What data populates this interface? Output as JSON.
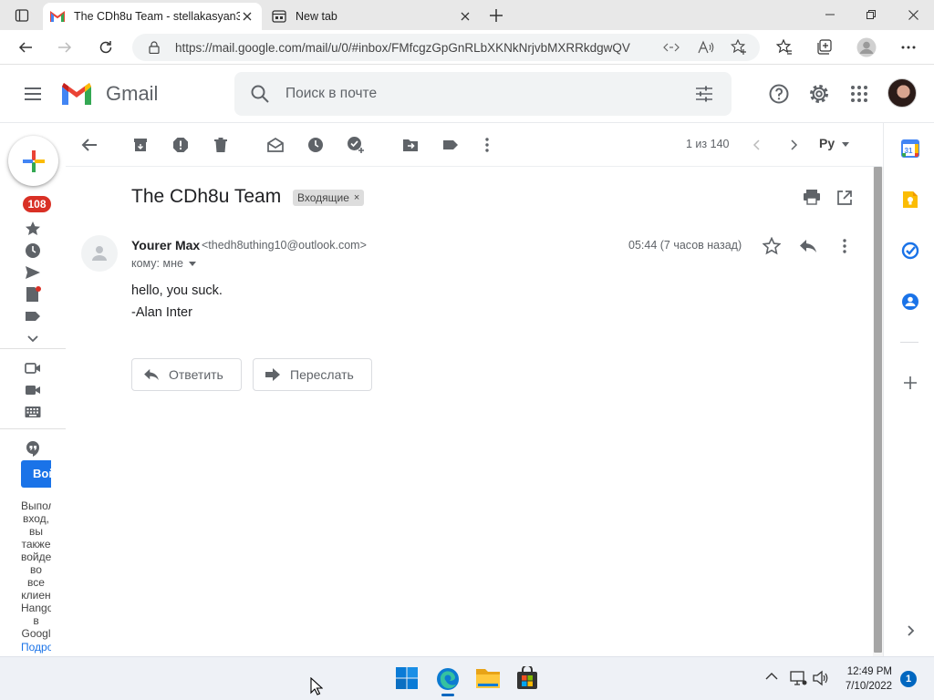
{
  "browser": {
    "tabs": [
      {
        "title": "The CDh8u Team - stellakasyan3",
        "icon": "gmail-icon",
        "active": true
      },
      {
        "title": "New tab",
        "icon": "new-tab-page-icon",
        "active": false
      }
    ],
    "url": "https://mail.google.com/mail/u/0/#inbox/FMfcgzGpGnRLbXKNkNrjvbMXRRkdgwQV"
  },
  "header": {
    "app_name": "Gmail",
    "search_placeholder": "Поиск в почте"
  },
  "left_rail": {
    "inbox_count": "108",
    "hangouts_button": "Войти",
    "hangouts_text_lines": [
      "Выпол",
      "вход,",
      "вы",
      "также",
      "войде",
      "во",
      "все",
      "клиен",
      "Hango",
      "в",
      "Googl"
    ],
    "hangouts_link": "Подро"
  },
  "toolbar": {
    "page_count": "1 из 140",
    "language": "Ру"
  },
  "message": {
    "subject": "The CDh8u Team",
    "label": "Входящие",
    "label_close": "×",
    "sender_name": "Yourer Max",
    "sender_email": "<thedh8uthing10@outlook.com>",
    "to_line": "кому: мне",
    "timestamp": "05:44 (7 часов назад)",
    "body_lines": [
      "hello, you suck.",
      "-Alan Inter"
    ],
    "reply_label": "Ответить",
    "forward_label": "Переслать"
  },
  "taskbar": {
    "time": "12:49 PM",
    "date": "7/10/2022",
    "notifications": "1"
  },
  "colors": {
    "accent": "#1a73e8",
    "badge_red": "#d93025"
  }
}
